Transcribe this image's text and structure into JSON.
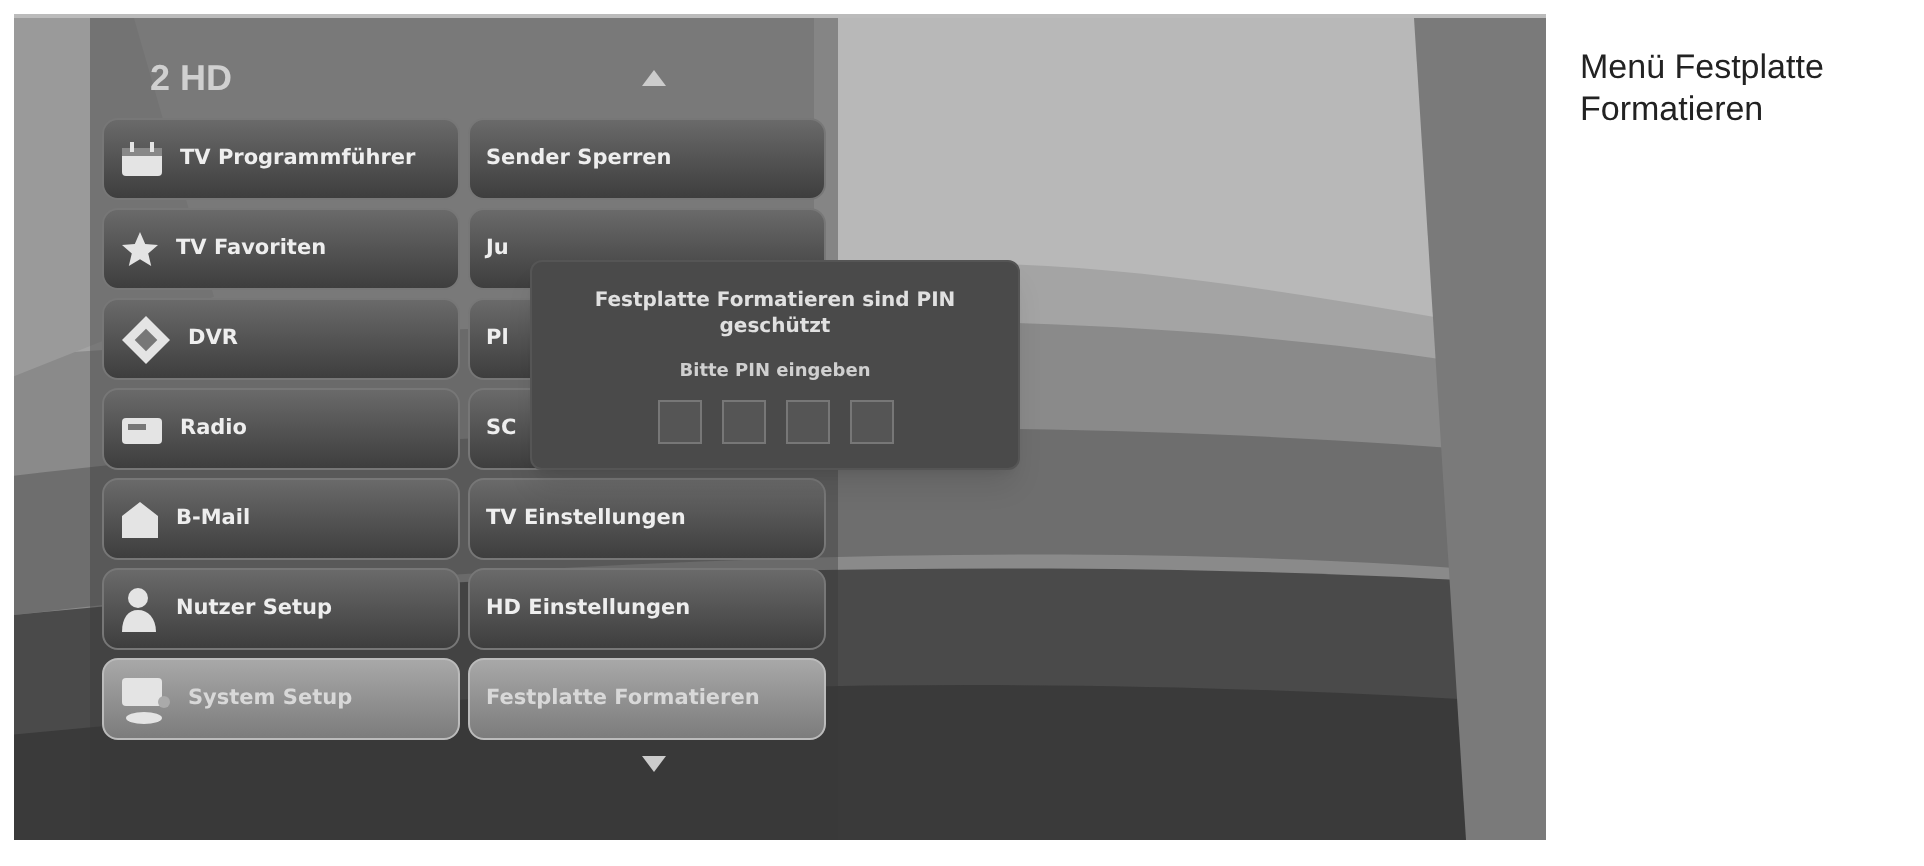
{
  "screen": {
    "logo": "2 HD",
    "menu_left": [
      {
        "label": "TV Programmführer",
        "selected": false
      },
      {
        "label": "TV Favoriten",
        "selected": false
      },
      {
        "label": "DVR",
        "selected": false
      },
      {
        "label": "Radio",
        "selected": false
      },
      {
        "label": "B-Mail",
        "selected": false
      },
      {
        "label": "Nutzer Setup",
        "selected": false
      },
      {
        "label": "System Setup",
        "selected": true
      }
    ],
    "menu_right": [
      {
        "label": "Sender Sperren",
        "selected": false
      },
      {
        "label": "Ju",
        "selected": false
      },
      {
        "label": "Pl",
        "selected": false
      },
      {
        "label": "SC",
        "selected": false
      },
      {
        "label": "TV Einstellungen",
        "selected": false
      },
      {
        "label": "HD Einstellungen",
        "selected": false
      },
      {
        "label": "Festplatte Formatieren",
        "selected": true
      }
    ],
    "pin_dialog": {
      "title": "Festplatte Formatieren  sind PIN geschützt",
      "prompt": "Bitte PIN eingeben"
    }
  },
  "caption": "Menü Festplatte Formatieren"
}
